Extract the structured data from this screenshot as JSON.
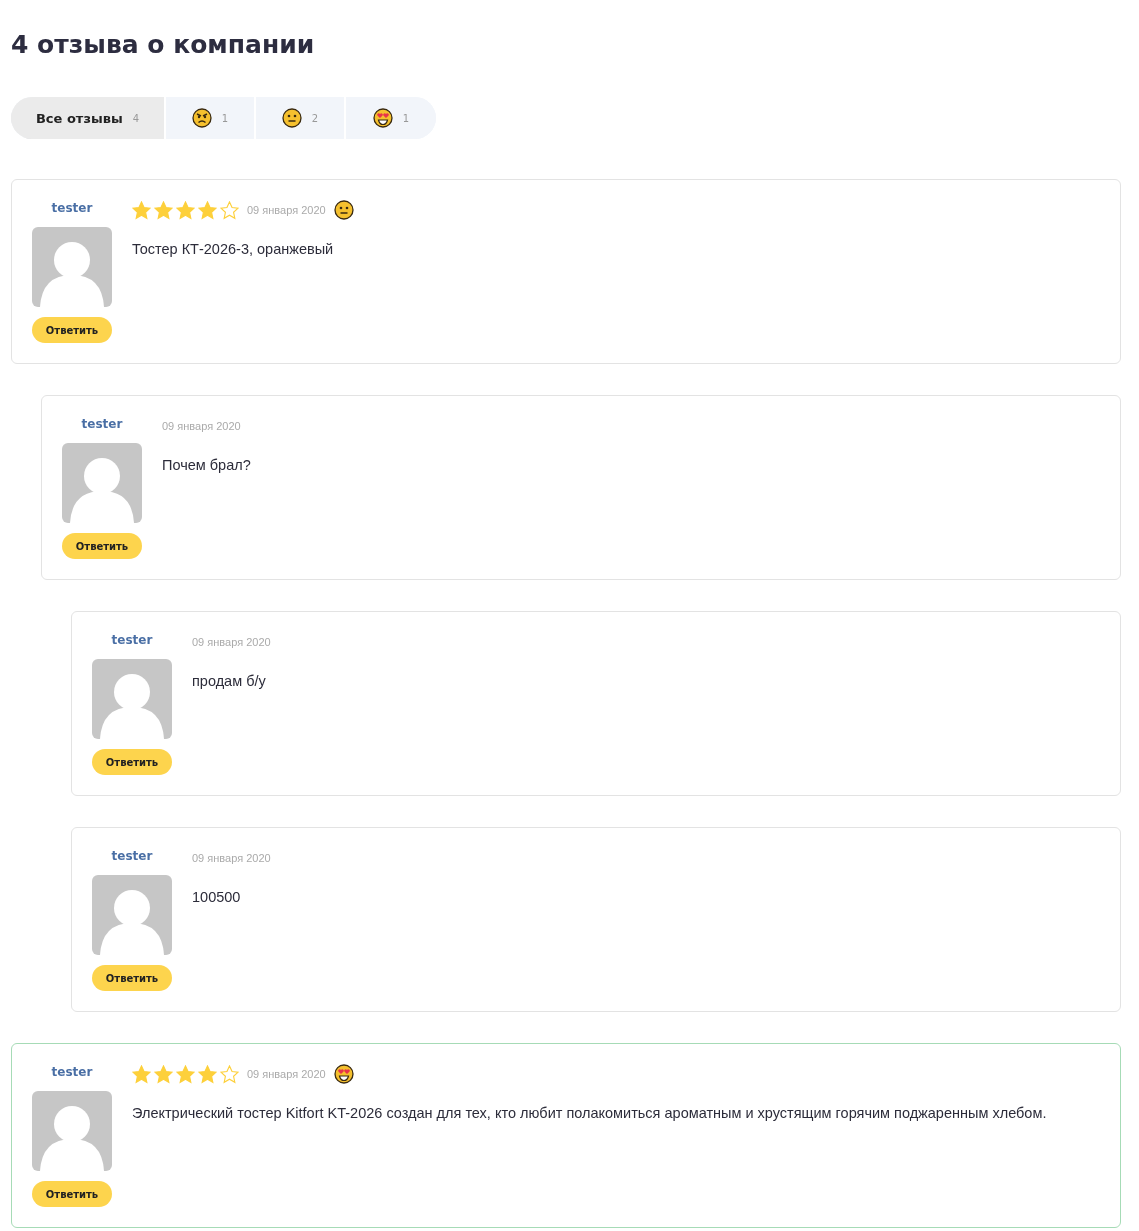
{
  "title": "4 отзыва о компании",
  "tabs": [
    {
      "kind": "all",
      "label": "Все отзывы",
      "count": "4",
      "selected": true
    },
    {
      "kind": "angry",
      "count": "1",
      "selected": false
    },
    {
      "kind": "neutral",
      "count": "2",
      "selected": false
    },
    {
      "kind": "love",
      "count": "1",
      "selected": false
    }
  ],
  "reviews": [
    {
      "author": "tester",
      "stars": 4,
      "date": "09 января 2020",
      "kind": "neutral",
      "text": "Тостер КТ-2026-3, оранжевый",
      "reply_label": "Ответить",
      "children": [
        {
          "author": "tester",
          "date": "09 января 2020",
          "text": "Почем брал?",
          "reply_label": "Ответить",
          "children": [
            {
              "author": "tester",
              "date": "09 января 2020",
              "text": "продам б/у",
              "reply_label": "Ответить"
            },
            {
              "author": "tester",
              "date": "09 января 2020",
              "text": "100500",
              "reply_label": "Ответить"
            }
          ]
        }
      ]
    },
    {
      "author": "tester",
      "stars": 4,
      "date": "09 января 2020",
      "kind": "love",
      "text": "Электрический тостер Kitfort KT-2026 создан для тех, кто любит полакомиться ароматным и хрустящим горячим поджаренным хлебом.",
      "reply_label": "Ответить"
    }
  ]
}
